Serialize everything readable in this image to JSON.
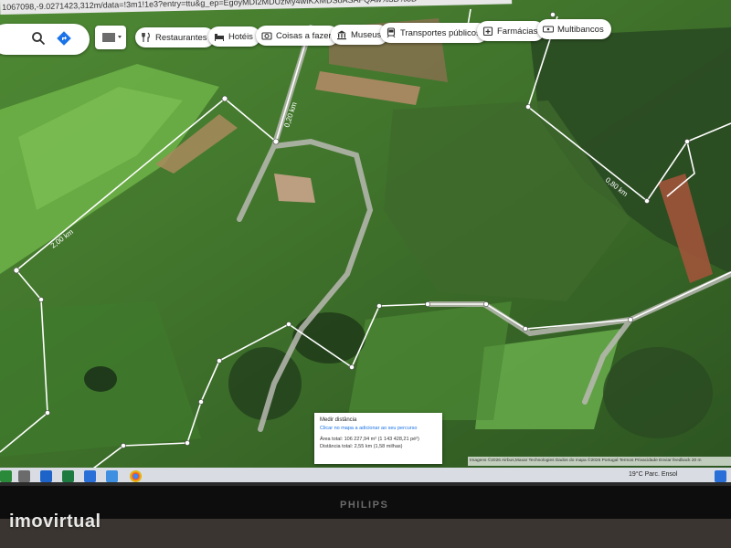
{
  "url": "1067098,-9.0271423,312m/data=!3m1!1e3?entry=ttu&g_ep=EgoyMDI2MDUzMy4wIKXMDSoASAFQAw%3D%3D",
  "chips": [
    {
      "label": "Restaurantes",
      "icon": "fork-knife-icon"
    },
    {
      "label": "Hotéis",
      "icon": "bed-icon"
    },
    {
      "label": "Coisas a fazer",
      "icon": "camera-icon"
    },
    {
      "label": "Museus",
      "icon": "museum-icon"
    },
    {
      "label": "Transportes públicos",
      "icon": "train-icon"
    },
    {
      "label": "Farmácias",
      "icon": "pharmacy-icon"
    },
    {
      "label": "Multibancos",
      "icon": "atm-icon"
    }
  ],
  "measure_labels": [
    "2,00 km",
    "0,20 km",
    "0,80 km"
  ],
  "distance_panel": {
    "title": "Medir distância",
    "hint": "Clicar no mapa a adicionar ao seu percurso",
    "area": "Área total: 106 227,94 m² (1 143 428,21 pé²)",
    "distance": "Distância total: 2,55 km (1,58 milhas)"
  },
  "attribution": "Imagens ©2026 Airbus,Maxar Technologies  Dados do mapa ©2026   Portugal   Termos   Privacidade   Enviar feedback   20 m",
  "weather": "19°C  Parc. Ensol",
  "brand": "PHILIPS",
  "watermark": "imovirtual",
  "colors": {
    "route": "#ffffff",
    "road": "#b9b9b2",
    "chip_bg": "#ffffff",
    "link": "#1a73e8"
  }
}
